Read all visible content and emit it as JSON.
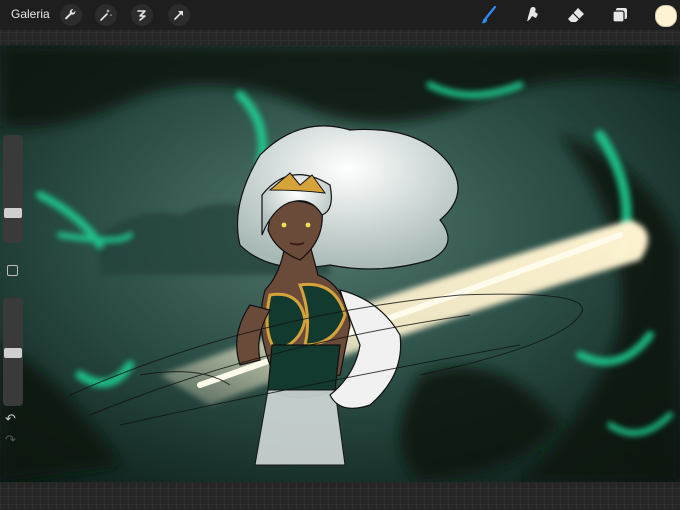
{
  "toolbar": {
    "gallery_label": "Galeria",
    "left_tools": [
      "wrench-icon",
      "magic-wand-icon",
      "selection-icon",
      "transform-icon"
    ],
    "right_tools": [
      "brush-icon",
      "smudge-icon",
      "eraser-icon",
      "layers-icon"
    ],
    "active_tool": "brush-icon",
    "accent_color": "#2f8df5",
    "current_color": "#fff4d2"
  },
  "sidebar": {
    "brush_size_level": 0.28,
    "opacity_level": 0.72,
    "modify_button_icon": "square-icon",
    "undo_icon": "undo-icon",
    "redo_icon": "redo-icon"
  },
  "canvas": {
    "artwork": "illustration",
    "palette": {
      "bg_dark": "#0b1a16",
      "bg_mid": "#2c5048",
      "mist": "#52776d",
      "emerald": "#1ed394",
      "glow": "#fff3d0",
      "skin": "#6a4a38",
      "hair": "#dfe7e6",
      "gold": "#d6a33b",
      "armor": "#123a2f",
      "gauntlet": "#f1f1f1"
    }
  }
}
